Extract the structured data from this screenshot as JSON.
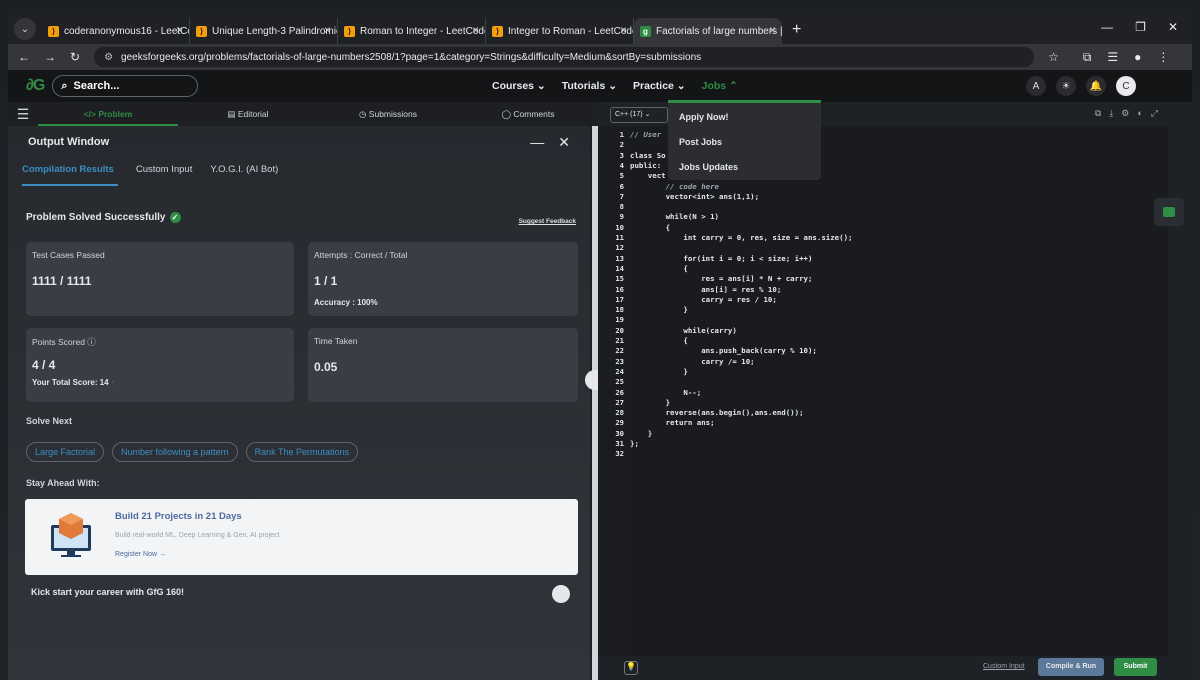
{
  "browser": {
    "tabs": [
      {
        "title": "coderanonymous16 - LeetCode"
      },
      {
        "title": "Unique Length-3 Palindromic S"
      },
      {
        "title": "Roman to Integer - LeetCode"
      },
      {
        "title": "Integer to Roman - LeetCode"
      },
      {
        "title": "Factorials of large numbers | Pr"
      }
    ],
    "url": "geeksforgeeks.org/problems/factorials-of-large-numbers2508/1?page=1&category=Strings&difficulty=Medium&sortBy=submissions"
  },
  "header": {
    "search_placeholder": "Search...",
    "nav": [
      "Courses",
      "Tutorials",
      "Practice",
      "Jobs"
    ],
    "avatar_letter": "C"
  },
  "jobs_menu": [
    "Apply Now!",
    "Post Jobs",
    "Jobs Updates"
  ],
  "problem_tabs": [
    "Problem",
    "Editorial",
    "Submissions",
    "Comments"
  ],
  "output": {
    "title": "Output Window",
    "tabs": [
      "Compilation Results",
      "Custom Input",
      "Y.O.G.I. (AI Bot)"
    ],
    "status": "Problem Solved Successfully",
    "suggest_feedback": "Suggest Feedback",
    "test_cases_label": "Test Cases Passed",
    "test_cases_value": "1111 / 1111",
    "attempts_label": "Attempts : Correct / Total",
    "attempts_value": "1 / 1",
    "accuracy": "Accuracy : 100%",
    "points_label": "Points Scored",
    "points_value": "4 / 4",
    "total_score": "Your Total Score: 14",
    "time_label": "Time Taken",
    "time_value": "0.05"
  },
  "solve_next": {
    "title": "Solve Next",
    "items": [
      "Large Factorial",
      "Number following a pattern",
      "Rank The Permutations"
    ]
  },
  "promo": {
    "section": "Stay Ahead With:",
    "title": "Build 21 Projects in 21 Days",
    "desc": "Build real-world ML, Deep Learning & Gen. AI project",
    "cta": "Register Now →"
  },
  "kickstart": "Kick start your career with GfG 160!",
  "editor": {
    "language": "C++ (17)",
    "lines": [
      {
        "n": "1",
        "t": "// User "
      },
      {
        "n": "2",
        "t": ""
      },
      {
        "n": "3",
        "t": "class So"
      },
      {
        "n": "4",
        "t": "public:"
      },
      {
        "n": "5",
        "t": "    vect"
      },
      {
        "n": "6",
        "t": "        // code here"
      },
      {
        "n": "7",
        "t": "        vector<int> ans(1,1);"
      },
      {
        "n": "8",
        "t": ""
      },
      {
        "n": "9",
        "t": "        while(N > 1)"
      },
      {
        "n": "10",
        "t": "        {"
      },
      {
        "n": "11",
        "t": "            int carry = 0, res, size = ans.size();"
      },
      {
        "n": "12",
        "t": ""
      },
      {
        "n": "13",
        "t": "            for(int i = 0; i < size; i++)"
      },
      {
        "n": "14",
        "t": "            {"
      },
      {
        "n": "15",
        "t": "                res = ans[i] * N + carry;"
      },
      {
        "n": "16",
        "t": "                ans[i] = res % 10;"
      },
      {
        "n": "17",
        "t": "                carry = res / 10;"
      },
      {
        "n": "18",
        "t": "            }"
      },
      {
        "n": "19",
        "t": ""
      },
      {
        "n": "20",
        "t": "            while(carry)"
      },
      {
        "n": "21",
        "t": "            {"
      },
      {
        "n": "22",
        "t": "                ans.push_back(carry % 10);"
      },
      {
        "n": "23",
        "t": "                carry /= 10;"
      },
      {
        "n": "24",
        "t": "            }"
      },
      {
        "n": "25",
        "t": ""
      },
      {
        "n": "26",
        "t": "            N--;"
      },
      {
        "n": "27",
        "t": "        }"
      },
      {
        "n": "28",
        "t": "        reverse(ans.begin(),ans.end());"
      },
      {
        "n": "29",
        "t": "        return ans;"
      },
      {
        "n": "30",
        "t": "    }"
      },
      {
        "n": "31",
        "t": "};"
      },
      {
        "n": "32",
        "t": ""
      }
    ],
    "custom_input": "Custom Input",
    "compile_run": "Compile & Run",
    "submit": "Submit"
  },
  "colors": {
    "brand": "#2f8d46",
    "link": "#3b8ec2"
  }
}
